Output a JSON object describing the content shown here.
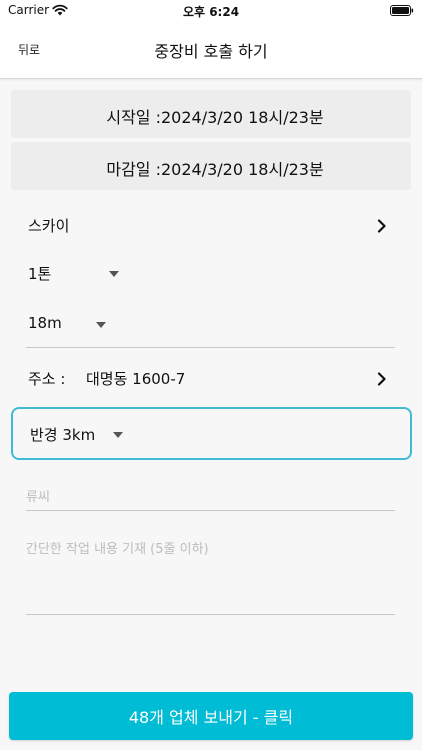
{
  "status_bar": {
    "carrier": "Carrier",
    "time": "오후 6:24"
  },
  "header": {
    "back_label": "뒤로",
    "title": "중장비 호출 하기"
  },
  "start_date": {
    "label": "시작일 :",
    "value": "2024/3/20 18시/23분"
  },
  "end_date": {
    "label": "마감일 :",
    "value": "2024/3/20 18시/23분"
  },
  "equipment": {
    "type": "스카이",
    "weight": "1톤",
    "height": "18m"
  },
  "address": {
    "label": "주소 :",
    "value": "대명동 1600-7"
  },
  "radius": {
    "value": "반경 3km"
  },
  "form": {
    "name_placeholder": "류씨",
    "description_placeholder": "간단한 작업 내용 기재 (5줄 이하)"
  },
  "submit": {
    "label": "48개 업체 보내기 - 클릭"
  },
  "colors": {
    "accent": "#00bcd4",
    "border_focus": "#3fbcd3"
  }
}
